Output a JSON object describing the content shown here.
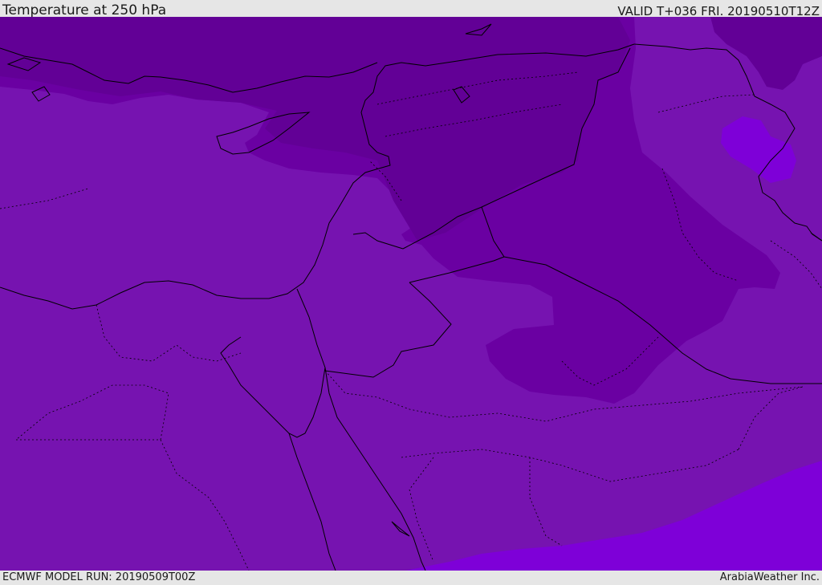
{
  "header": {
    "title": "Temperature at 250 hPa",
    "valid": "VALID T+036 FRI. 20190510T12Z"
  },
  "footer": {
    "model_run": "ECMWF MODEL RUN: 20190509T00Z",
    "credit": "ArabiaWeather Inc."
  },
  "map": {
    "field": "temperature",
    "level": "250 hPa",
    "colors": {
      "coldest": "#620096",
      "cold": "#6a00a2",
      "mid": "#7613b0",
      "warm": "#7e00d8",
      "coastline": "#000000"
    }
  }
}
